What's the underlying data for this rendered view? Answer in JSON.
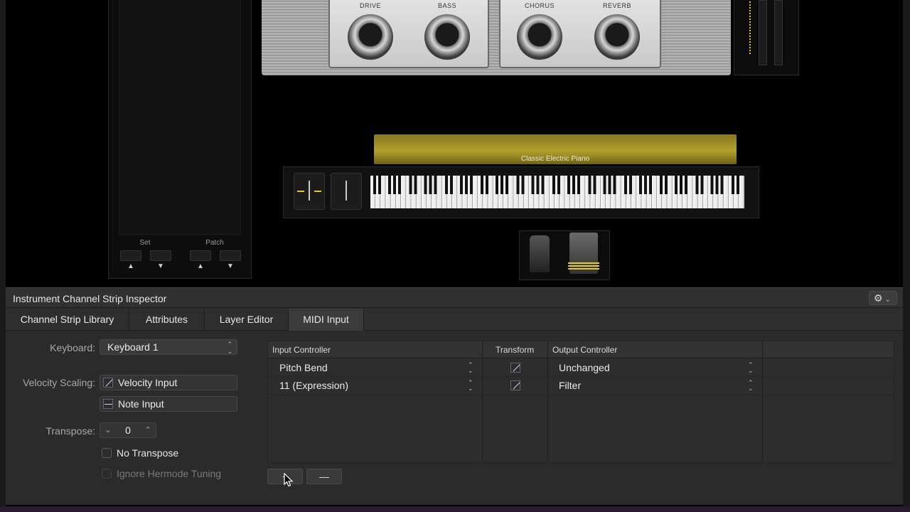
{
  "left_panel": {
    "set_label": "Set",
    "patch_label": "Patch",
    "arrow_up": "▲",
    "arrow_down": "▼"
  },
  "amp": {
    "knobs": [
      "DRIVE",
      "BASS",
      "CHORUS",
      "REVERB"
    ]
  },
  "instrument": {
    "name": "Classic Electric Piano"
  },
  "inspector": {
    "title": "Instrument Channel Strip Inspector",
    "gear_icon": "⚙",
    "gear_chevron": "⌄",
    "tabs": [
      "Channel Strip Library",
      "Attributes",
      "Layer Editor",
      "MIDI Input"
    ],
    "active_tab": "MIDI Input"
  },
  "midi_input": {
    "keyboard_label": "Keyboard:",
    "keyboard_value": "Keyboard 1",
    "velocity_label": "Velocity Scaling:",
    "velocity_input": "Velocity Input",
    "note_input": "Note Input",
    "transpose_label": "Transpose:",
    "transpose_value": "0",
    "no_transpose": "No Transpose",
    "ignore_hermode": "Ignore Hermode Tuning",
    "table": {
      "columns": [
        "Input Controller",
        "Transform",
        "Output Controller"
      ],
      "rows": [
        {
          "input": "Pitch Bend",
          "output": "Unchanged"
        },
        {
          "input": "11 (Expression)",
          "output": "Filter"
        }
      ]
    },
    "add_button": "+",
    "remove_button": "—"
  }
}
